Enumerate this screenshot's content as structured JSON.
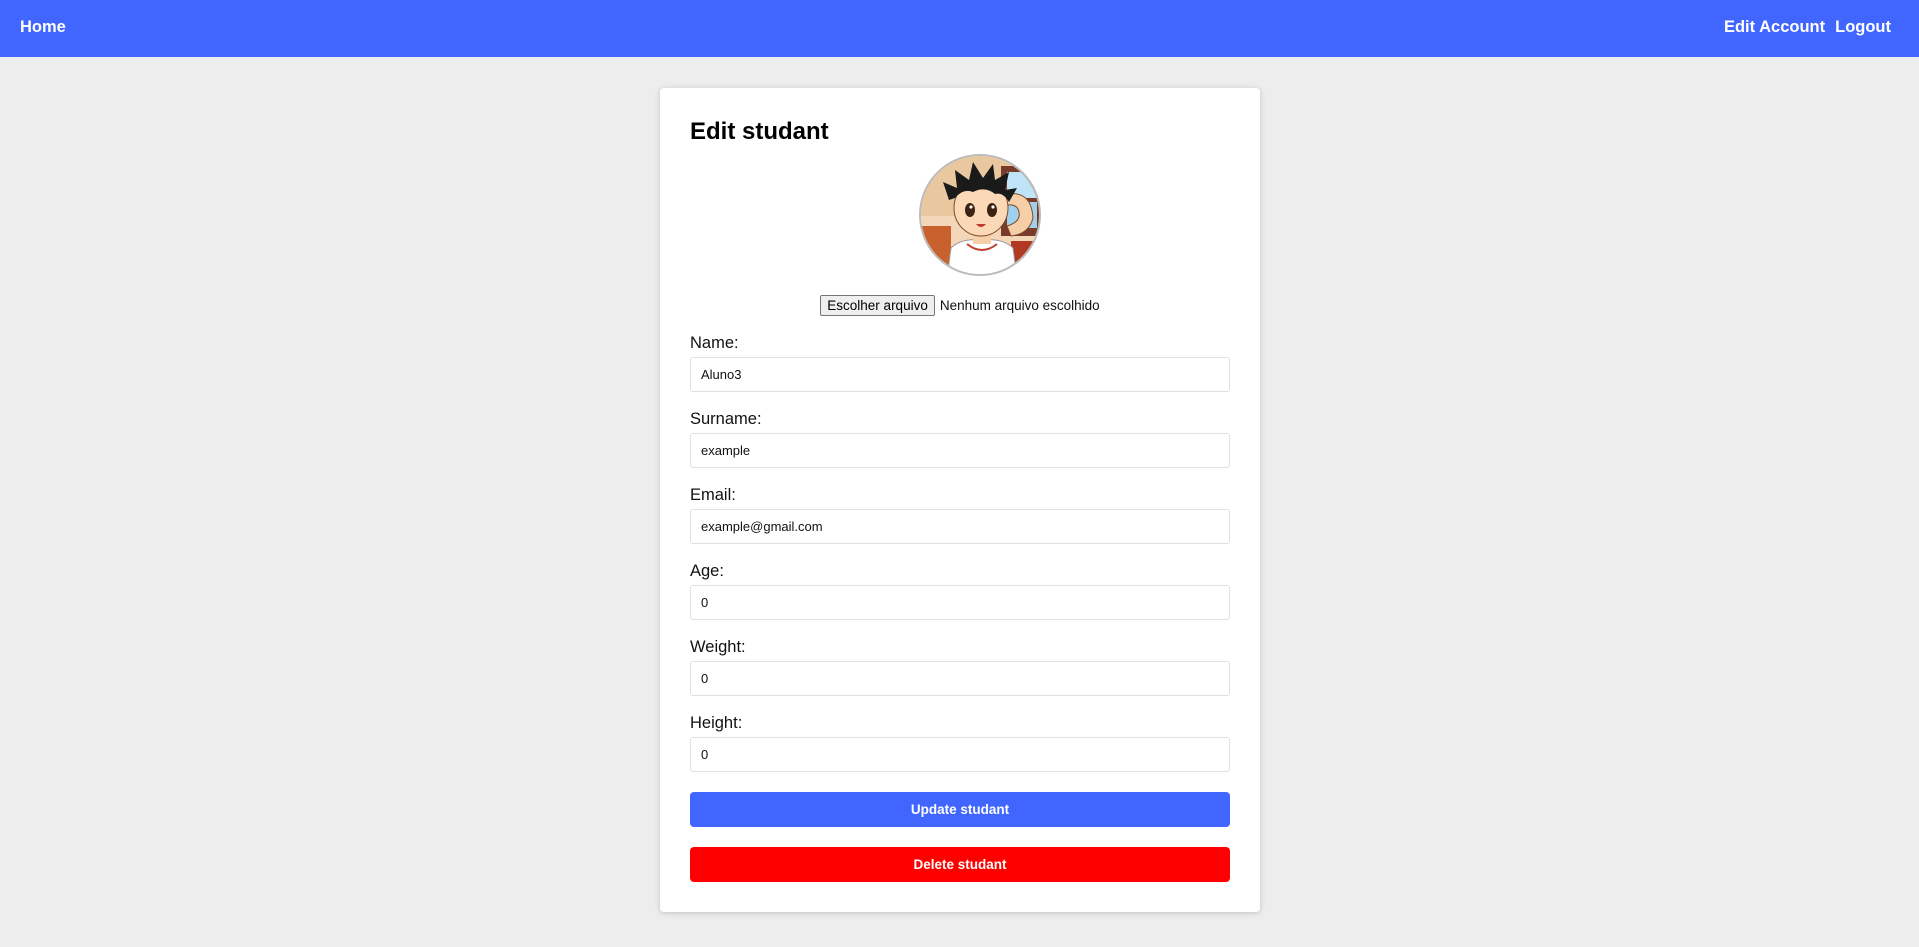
{
  "navbar": {
    "home_label": "Home",
    "edit_account_label": "Edit Account",
    "logout_label": "Logout"
  },
  "form": {
    "title": "Edit studant",
    "file_button_label": "Escolher arquivo",
    "file_status": "Nenhum arquivo escolhido",
    "fields": [
      {
        "label": "Name:",
        "value": "Aluno3"
      },
      {
        "label": "Surname:",
        "value": "example"
      },
      {
        "label": "Email:",
        "value": "example@gmail.com"
      },
      {
        "label": "Age:",
        "value": "0"
      },
      {
        "label": "Weight:",
        "value": "0"
      },
      {
        "label": "Height:",
        "value": "0"
      }
    ],
    "update_label": "Update studant",
    "delete_label": "Delete studant"
  },
  "colors": {
    "navbar": "#4165ff",
    "update_button": "#4165ff",
    "delete_button": "#ff0000",
    "background": "#ededed"
  }
}
